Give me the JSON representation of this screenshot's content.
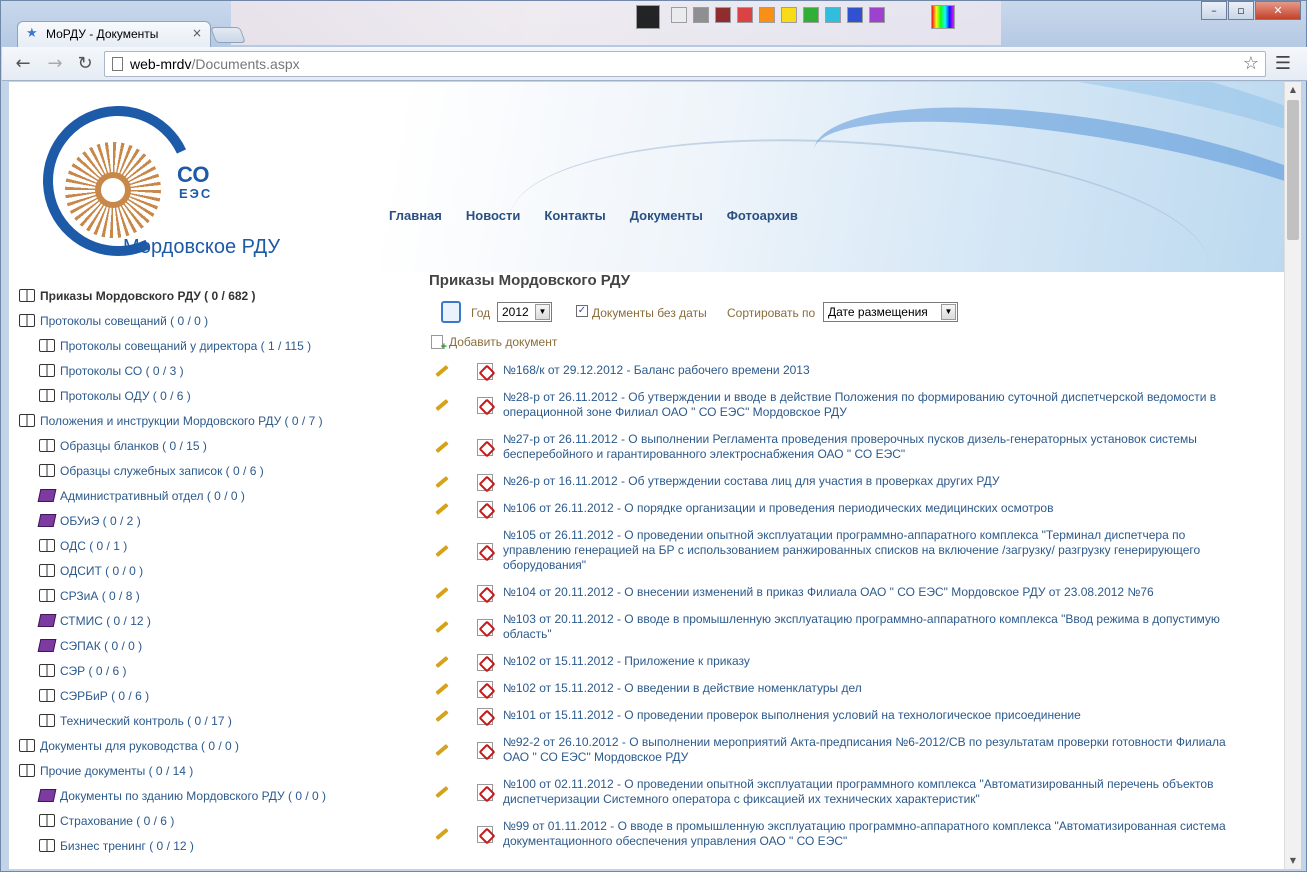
{
  "browser": {
    "tab_title": "МоРДУ - Документы",
    "url_host": "web-mrdv",
    "url_path": "/Documents.aspx",
    "close_glyph": "×"
  },
  "logo": {
    "co": "СО",
    "ees": "ЕЭС",
    "name": "Мордовское РДУ"
  },
  "topnav": [
    "Главная",
    "Новости",
    "Контакты",
    "Документы",
    "Фотоархив"
  ],
  "sidebar": [
    {
      "label": "Приказы Мордовского РДУ",
      "count": "( 0 / 682 )",
      "level": 1,
      "icon": "open-book-icon",
      "active": true
    },
    {
      "label": "Протоколы совещаний",
      "count": "( 0 / 0 )",
      "level": 1,
      "icon": "open-book-icon"
    },
    {
      "label": "Протоколы совещаний у директора",
      "count": "( 1 / 115 )",
      "level": 2,
      "icon": "open-book-icon"
    },
    {
      "label": "Протоколы СО",
      "count": "( 0 / 3 )",
      "level": 2,
      "icon": "open-book-icon"
    },
    {
      "label": "Протоколы ОДУ",
      "count": "( 0 / 6 )",
      "level": 2,
      "icon": "open-book-icon"
    },
    {
      "label": "Положения и инструкции Мордовского РДУ",
      "count": "( 0 / 7 )",
      "level": 1,
      "icon": "open-book-icon"
    },
    {
      "label": "Образцы бланков",
      "count": "( 0 / 15 )",
      "level": 2,
      "icon": "open-book-icon"
    },
    {
      "label": "Образцы служебных записок",
      "count": "( 0 / 6 )",
      "level": 2,
      "icon": "open-book-icon"
    },
    {
      "label": "Административный отдел",
      "count": "( 0 / 0 )",
      "level": 2,
      "icon": "closed-book-icon"
    },
    {
      "label": "ОБУиЭ",
      "count": "( 0 / 2 )",
      "level": 2,
      "icon": "closed-book-icon"
    },
    {
      "label": "ОДС",
      "count": "( 0 / 1 )",
      "level": 2,
      "icon": "open-book-icon"
    },
    {
      "label": "ОДСИТ",
      "count": "( 0 / 0 )",
      "level": 2,
      "icon": "open-book-icon"
    },
    {
      "label": "СРЗиА",
      "count": "( 0 / 8 )",
      "level": 2,
      "icon": "open-book-icon"
    },
    {
      "label": "СТМИС",
      "count": "( 0 / 12 )",
      "level": 2,
      "icon": "closed-book-icon"
    },
    {
      "label": "СЭПАК",
      "count": "( 0 / 0 )",
      "level": 2,
      "icon": "closed-book-icon"
    },
    {
      "label": "СЭР",
      "count": "( 0 / 6 )",
      "level": 2,
      "icon": "open-book-icon"
    },
    {
      "label": "СЭРБиР",
      "count": "( 0 / 6 )",
      "level": 2,
      "icon": "open-book-icon"
    },
    {
      "label": "Технический контроль",
      "count": "( 0 / 17 )",
      "level": 2,
      "icon": "open-book-icon"
    },
    {
      "label": "Документы для руководства",
      "count": "( 0 / 0 )",
      "level": 1,
      "icon": "open-book-icon"
    },
    {
      "label": "Прочие документы",
      "count": "( 0 / 14 )",
      "level": 1,
      "icon": "open-book-icon"
    },
    {
      "label": "Документы по зданию Мордовского РДУ",
      "count": "( 0 / 0 )",
      "level": 2,
      "icon": "closed-book-icon"
    },
    {
      "label": "Страхование",
      "count": "( 0 / 6 )",
      "level": 2,
      "icon": "open-book-icon"
    },
    {
      "label": "Бизнес тренинг",
      "count": "( 0 / 12 )",
      "level": 2,
      "icon": "open-book-icon"
    }
  ],
  "main": {
    "heading": "Приказы Мордовского РДУ",
    "year_label": "Год",
    "year_value": "2012",
    "undated_label": "Документы без даты",
    "undated_checked": true,
    "sort_label": "Сортировать по",
    "sort_value": "Дате размещения",
    "add_document": "Добавить документ"
  },
  "documents": [
    {
      "lines": [
        "№168/к от 29.12.2012 - Баланс рабочего времени 2013"
      ]
    },
    {
      "lines": [
        "№28-р от 26.11.2012 - Об утверждении и вводе в действие Положения по формированию суточной диспетчерской ведомости в",
        "операционной зоне Филиал ОАО \" СО ЕЭС\" Мордовское РДУ"
      ]
    },
    {
      "lines": [
        "№27-р от 26.11.2012 - О выполнении Регламента проведения проверочных пусков дизель-генераторных установок системы",
        "бесперебойного и гарантированного электроснабжения ОАО \" СО ЕЭС\""
      ]
    },
    {
      "lines": [
        "№26-р от 16.11.2012 - Об утверждении состава лиц для участия в проверках других РДУ"
      ]
    },
    {
      "lines": [
        "№106 от 26.11.2012 - О порядке организации и проведения периодических медицинских осмотров"
      ]
    },
    {
      "lines": [
        "№105 от 26.11.2012 - О проведении опытной эксплуатации программно-аппаратного комплекса \"Терминал диспетчера по",
        "управлению генерацией на БР с использованием ранжированных списков на включение /загрузку/ разгрузку генерирующего",
        "оборудования\""
      ]
    },
    {
      "lines": [
        "№104 от 20.11.2012 - О внесении изменений в приказ Филиала ОАО \" СО ЕЭС\" Мордовское РДУ от 23.08.2012 №76"
      ]
    },
    {
      "lines": [
        "№103 от 20.11.2012 - О вводе в промышленную эксплуатацию программно-аппаратного комплекса \"Ввод режима в допустимую",
        "область\""
      ]
    },
    {
      "lines": [
        "№102 от 15.11.2012 - Приложение к приказу"
      ]
    },
    {
      "lines": [
        "№102 от 15.11.2012 - О введении в действие номенклатуры дел"
      ]
    },
    {
      "lines": [
        "№101 от 15.11.2012 - О проведении проверок выполнения условий на технологическое присоединение"
      ]
    },
    {
      "lines": [
        "№92-2 от 26.10.2012 - О выполнении мероприятий Акта-предписания №6-2012/СВ по результатам проверки готовности Филиала",
        "ОАО \" СО ЕЭС\" Мордовское РДУ"
      ]
    },
    {
      "lines": [
        "№100 от 02.11.2012 - О проведении опытной эксплуатации программного комплекса \"Автоматизированный перечень объектов",
        "диспетчеризации Системного оператора с фиксацией их технических характеристик\""
      ]
    },
    {
      "lines": [
        "№99 от 01.11.2012 - О вводе в промышленную эксплуатацию программно-аппаратного комплекса \"Автоматизированная система",
        "документационного обеспечения управления ОАО \" СО ЕЭС\""
      ]
    }
  ]
}
